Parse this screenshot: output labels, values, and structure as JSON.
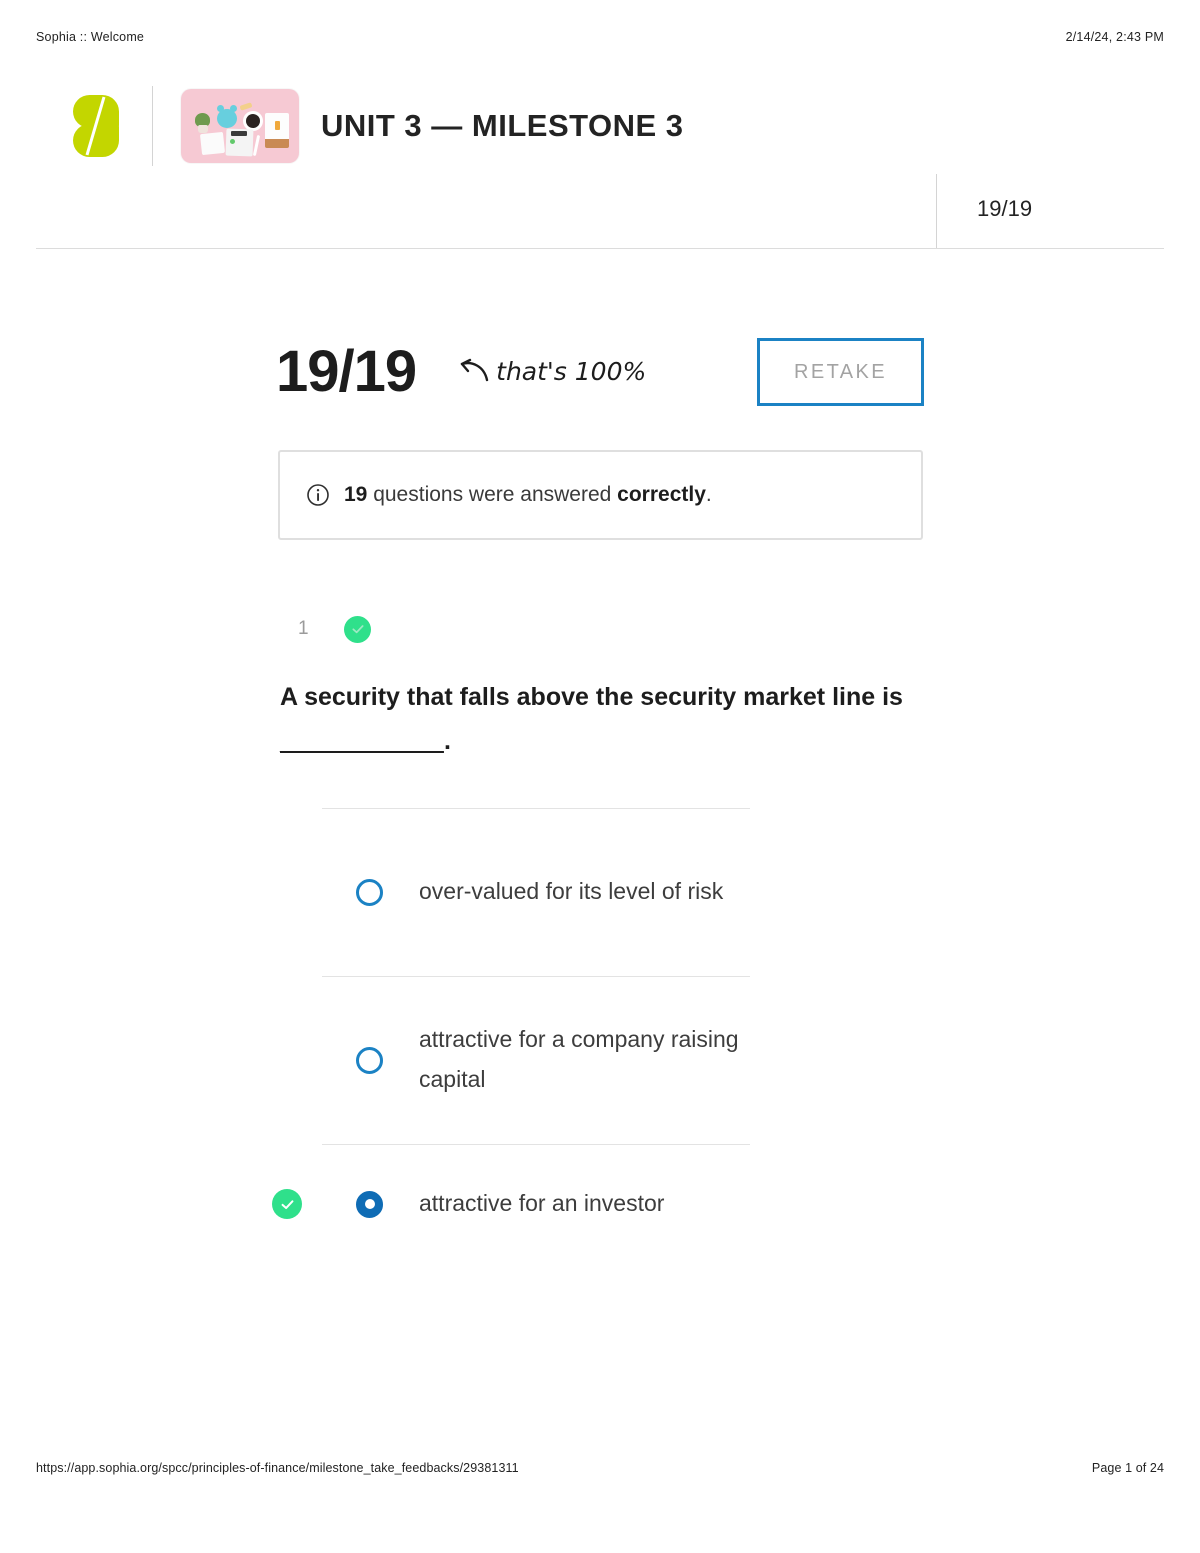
{
  "print": {
    "header_title": "Sophia :: Welcome",
    "header_timestamp": "2/14/24, 2:43 PM",
    "footer_url": "https://app.sophia.org/spcc/principles-of-finance/milestone_take_feedbacks/29381311",
    "footer_page": "Page 1 of 24"
  },
  "header": {
    "logo_name": "sophia-logo",
    "thumbnail_name": "course-thumbnail",
    "title": "UNIT 3 — MILESTONE 3",
    "score_cell": "19/19"
  },
  "results": {
    "big_score": "19/19",
    "note": "that's 100%",
    "retake_label": "RETAKE",
    "info": {
      "count": "19",
      "middle": " questions were answered ",
      "emphasis": "correctly",
      "period": "."
    }
  },
  "question": {
    "number": "1",
    "status": "correct",
    "text_line1": "A security that falls above the security market line is",
    "blank": "___________",
    "period": ".",
    "options": [
      {
        "label": "over-valued for its level of risk",
        "selected": false,
        "correct": false
      },
      {
        "label": "attractive for a company raising capital",
        "selected": false,
        "correct": false
      },
      {
        "label": "attractive for an investor",
        "selected": true,
        "correct": true
      }
    ]
  },
  "colors": {
    "brand_lime": "#c3d600",
    "accent_blue": "#1b82c4",
    "selected_blue": "#0f6cb5",
    "success_green": "#2fe08b",
    "thumb_pink": "#f6c9d3"
  }
}
